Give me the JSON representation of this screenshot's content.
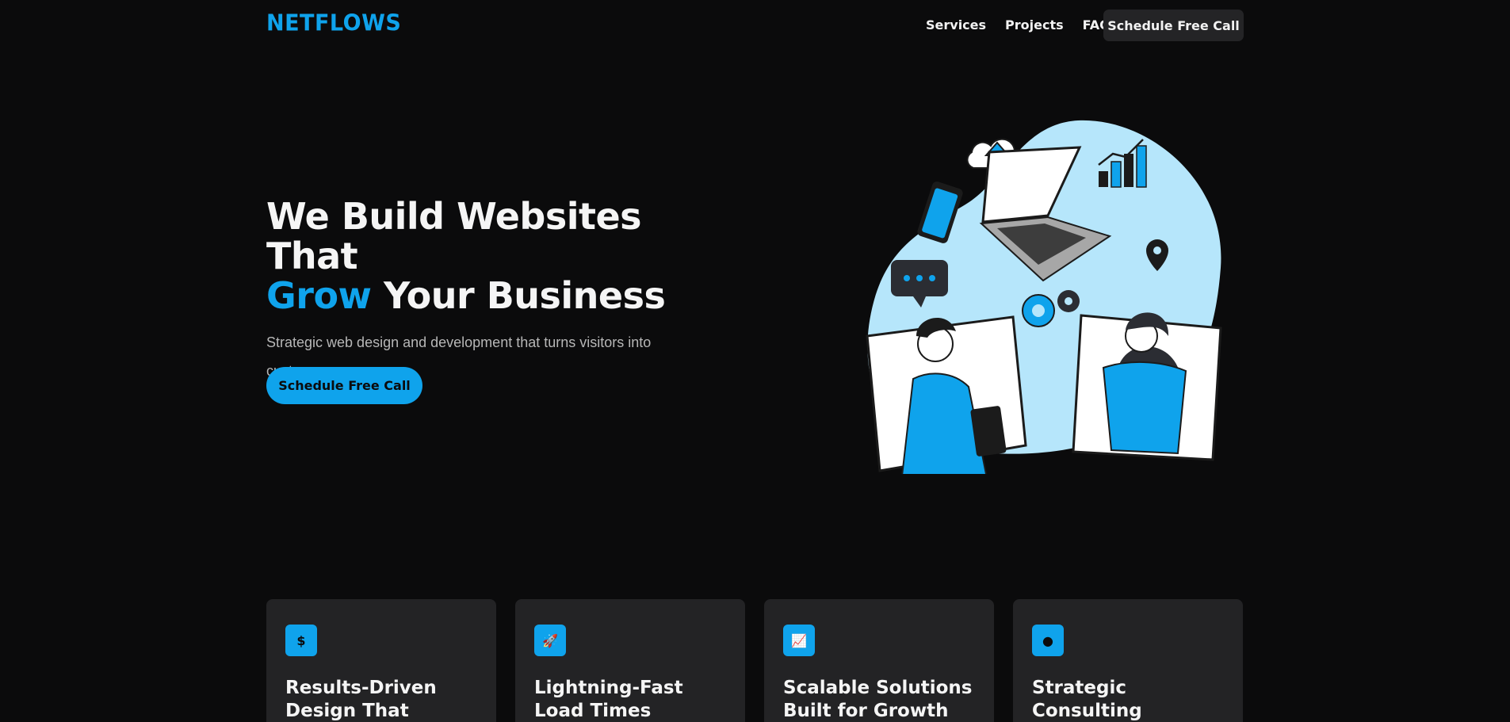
{
  "brand": {
    "logo": "Netflows",
    "accent_color": "#0fa3ec",
    "background": "#0b0b0c"
  },
  "nav": {
    "links": [
      "Services",
      "Projects",
      "FAQ"
    ],
    "cta": "Schedule Free Call"
  },
  "hero": {
    "title_line1": "We Build Websites That",
    "title_accent": "Grow",
    "title_line2_rest": " Your Business",
    "subtitle": "Strategic web design and development that turns visitors into customers.",
    "cta": "Schedule Free Call"
  },
  "features": [
    {
      "icon": "dollar-icon",
      "glyph": "$",
      "title": "Results-Driven Design That Converts"
    },
    {
      "icon": "rocket-icon",
      "glyph": "🚀",
      "title": "Lightning-Fast Load Times"
    },
    {
      "icon": "chart-line-icon",
      "glyph": "📈",
      "title": "Scalable Solutions Built for Growth"
    },
    {
      "icon": "brain-icon",
      "glyph": "●",
      "title": "Strategic Consulting Included"
    }
  ]
}
